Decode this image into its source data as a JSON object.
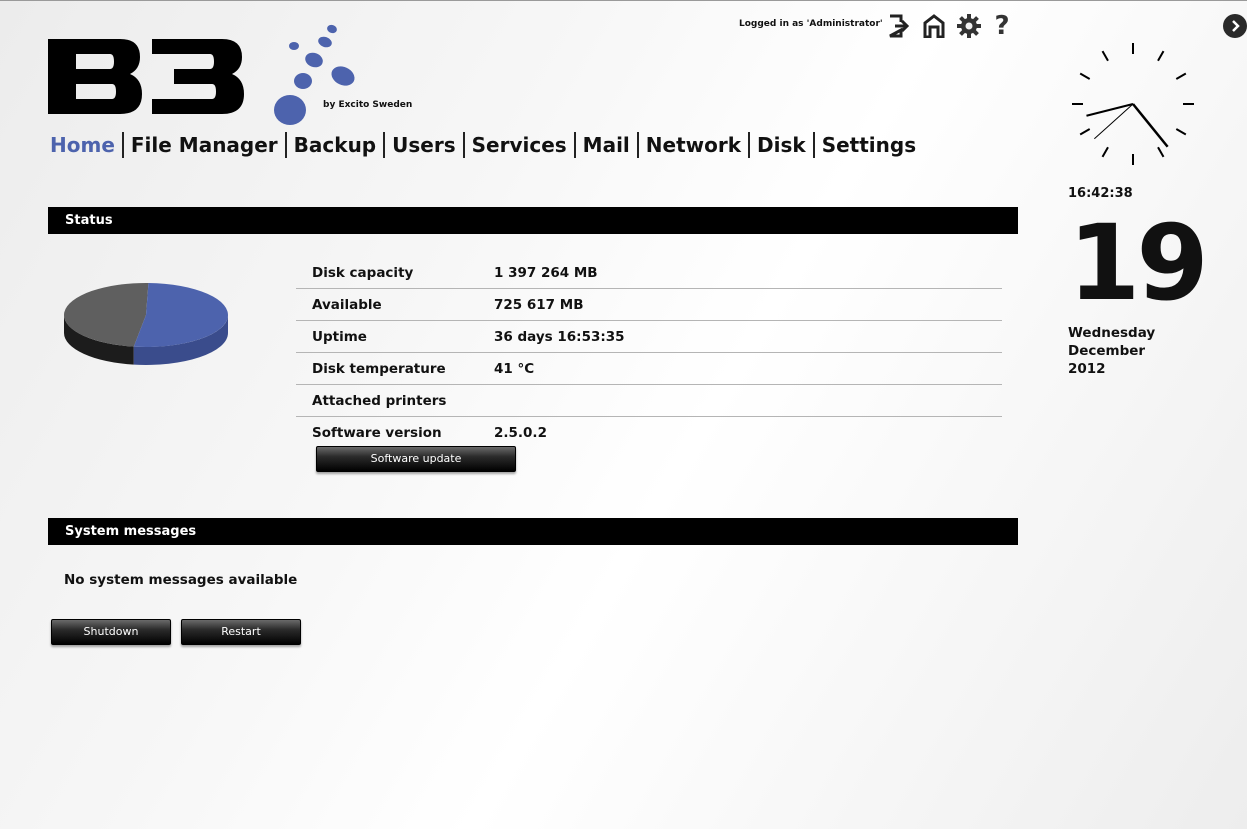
{
  "brand": {
    "byline": "by Excito Sweden"
  },
  "user": {
    "logged_in_text": "Logged in as 'Administrator'"
  },
  "top_icons": [
    "logout-icon",
    "home-icon",
    "settings-gear-icon",
    "help-icon"
  ],
  "nav": [
    {
      "label": "Home",
      "active": true
    },
    {
      "label": "File Manager"
    },
    {
      "label": "Backup"
    },
    {
      "label": "Users"
    },
    {
      "label": "Services"
    },
    {
      "label": "Mail"
    },
    {
      "label": "Network"
    },
    {
      "label": "Disk"
    },
    {
      "label": "Settings"
    }
  ],
  "status": {
    "title": "Status",
    "rows": [
      {
        "label": "Disk capacity",
        "value": "1 397 264 MB"
      },
      {
        "label": "Available",
        "value": "725 617 MB"
      },
      {
        "label": "Uptime",
        "value": "36 days 16:53:35"
      },
      {
        "label": "Disk temperature",
        "value": "41 °C"
      },
      {
        "label": "Attached printers",
        "value": ""
      },
      {
        "label": "Software version",
        "value": "2.5.0.2"
      }
    ],
    "update_button": "Software update",
    "disk_usage": {
      "available_fraction": 0.519,
      "colors": {
        "available": "#4d63ad",
        "used": "#5f5f5f"
      }
    }
  },
  "messages": {
    "title": "System messages",
    "empty_text": "No system messages available"
  },
  "actions": {
    "shutdown": "Shutdown",
    "restart": "Restart"
  },
  "clock": {
    "time": "16:42:38",
    "day": "19",
    "weekday": "Wednesday",
    "month": "December",
    "year": "2012"
  },
  "colors": {
    "accent": "#4d63ad",
    "bar": "#000000"
  }
}
